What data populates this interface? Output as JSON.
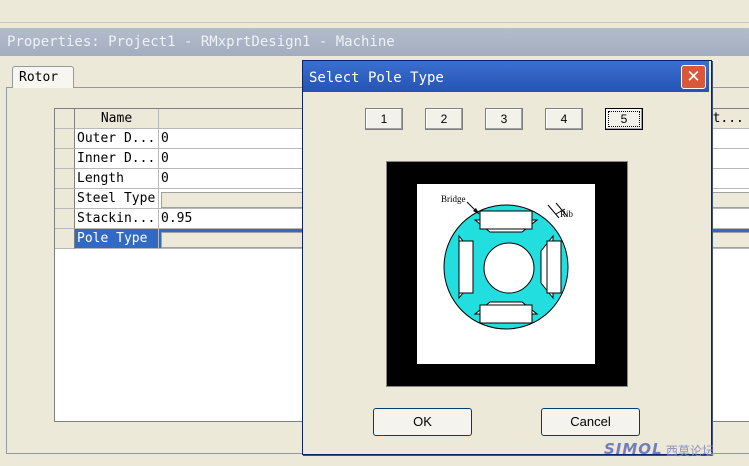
{
  "window": {
    "title": "Properties: Project1 - RMxprtDesign1 - Machine"
  },
  "tabs": [
    {
      "label": "Rotor"
    }
  ],
  "grid": {
    "columns": {
      "name": "Name",
      "value": "",
      "extra": "...t..."
    },
    "rows": [
      {
        "name": "Outer D...",
        "value": "0"
      },
      {
        "name": "Inner D...",
        "value": "0"
      },
      {
        "name": "Length",
        "value": "0"
      },
      {
        "name": "Steel Type",
        "value": ""
      },
      {
        "name": "Stackin...",
        "value": "0.95"
      },
      {
        "name": "Pole Type",
        "value": ""
      }
    ],
    "selected_row": "Pole Type"
  },
  "dialog": {
    "title": "Select Pole Type",
    "pole_buttons": [
      "1",
      "2",
      "3",
      "4",
      "5"
    ],
    "selected_pole": "5",
    "diagram": {
      "bridge_label": "Bridge",
      "rib_label": "Rib"
    },
    "ok_label": "OK",
    "cancel_label": "Cancel"
  },
  "watermark": {
    "brand": "SIMOL",
    "cjk": "西莫论坛"
  },
  "colors": {
    "titlebar_active": "#2553b3",
    "titlebar_inactive": "#a4adbf",
    "selection": "#316ac5",
    "rotor_cyan": "#22dede",
    "close_button": "#d9583a"
  }
}
